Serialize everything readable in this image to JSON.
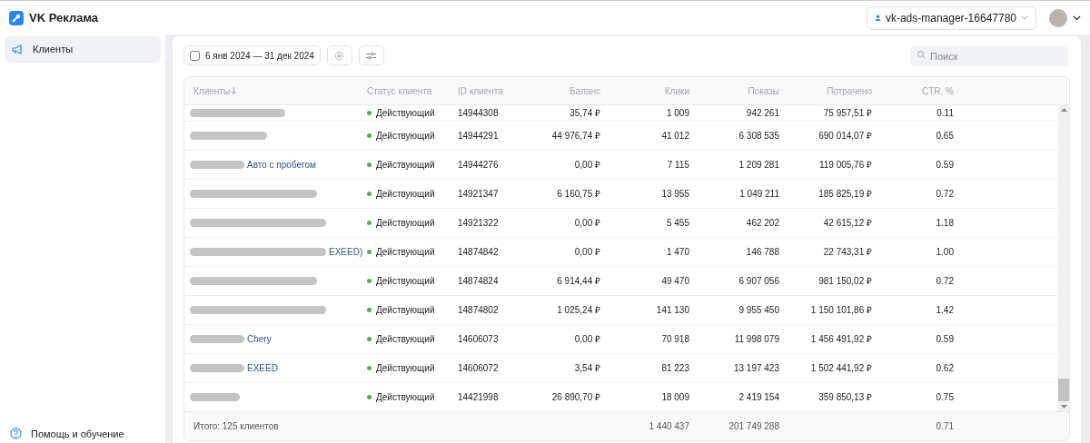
{
  "topbar": {
    "brand": "VK Реклама",
    "account": "vk-ads-manager-16647780"
  },
  "sidebar": {
    "items": [
      {
        "label": "Клиенты",
        "selected": true
      }
    ],
    "help": "Помощь и обучение"
  },
  "toolbar": {
    "date_range": "6 янв 2024 — 31 дек 2024",
    "search": {
      "placeholder": "Поиск"
    }
  },
  "table": {
    "columns": [
      "Клиенты",
      "Статус клиента",
      "ID клиента",
      "Баланс",
      "Клики",
      "Показы",
      "Потрачено",
      "CTR, %"
    ],
    "rows": [
      {
        "status": "Действующий",
        "color": "#4bb34b",
        "id": "14944308",
        "balance": "35,74 ₽",
        "clicks": "1 009",
        "shows": "942 261",
        "spent": "75 957,51 ₽",
        "ctr": "0.11"
      },
      {
        "status": "Действующий",
        "color": "#4bb34b",
        "id": "14944291",
        "balance": "44 976,74 ₽",
        "clicks": "41 012",
        "shows": "6 308 535",
        "spent": "690 014,07 ₽",
        "ctr": "0.65"
      },
      {
        "client_name": "Авто с пробегом",
        "status": "Действующий",
        "color": "#4bb34b",
        "id": "14944276",
        "balance": "0,00 ₽",
        "clicks": "7 115",
        "shows": "1 209 281",
        "spent": "119 005,76 ₽",
        "ctr": "0.59"
      },
      {
        "status": "Действующий",
        "color": "#4bb34b",
        "id": "14921347",
        "balance": "6 160,75 ₽",
        "clicks": "13 955",
        "shows": "1 049 211",
        "spent": "185 825,19 ₽",
        "ctr": "0.72"
      },
      {
        "status": "Действующий",
        "color": "#4bb34b",
        "id": "14921322",
        "balance": "0,00 ₽",
        "clicks": "5 455",
        "shows": "462 202",
        "spent": "42 615,12 ₽",
        "ctr": "1.18"
      },
      {
        "client_name": "EXEED)",
        "status": "Действующий",
        "color": "#4bb34b",
        "id": "14874842",
        "balance": "0,00 ₽",
        "clicks": "1 470",
        "shows": "146 788",
        "spent": "22 743,31 ₽",
        "ctr": "1.00"
      },
      {
        "status": "Действующий",
        "color": "#4bb34b",
        "id": "14874824",
        "balance": "6 914,44 ₽",
        "clicks": "49 470",
        "shows": "6 907 056",
        "spent": "981 150,02 ₽",
        "ctr": "0.72"
      },
      {
        "status": "Действующий",
        "color": "#4bb34b",
        "id": "14874802",
        "balance": "1 025,24 ₽",
        "clicks": "141 130",
        "shows": "9 955 450",
        "spent": "1 150 101,86 ₽",
        "ctr": "1.42"
      },
      {
        "client_name": "Chery",
        "status": "Действующий",
        "color": "#4bb34b",
        "id": "14606073",
        "balance": "0,00 ₽",
        "clicks": "70 918",
        "shows": "11 998 079",
        "spent": "1 456 491,92 ₽",
        "ctr": "0.59"
      },
      {
        "client_name": "EXEED",
        "status": "Действующий",
        "color": "#4bb34b",
        "id": "14606072",
        "balance": "3,54 ₽",
        "clicks": "81 223",
        "shows": "13 197 423",
        "spent": "1 502 441,92 ₽",
        "ctr": "0.62"
      },
      {
        "status": "Действующий",
        "color": "#4bb34b",
        "id": "14421998",
        "balance": "26 890,70 ₽",
        "clicks": "18 009",
        "shows": "2 419 154",
        "spent": "359 850,13 ₽",
        "ctr": "0.75"
      }
    ],
    "footer": {
      "total": "Итого: 125 клиентов",
      "clicks": "1 440 437",
      "shows": "201 749 288",
      "ctr": "0.71"
    }
  }
}
